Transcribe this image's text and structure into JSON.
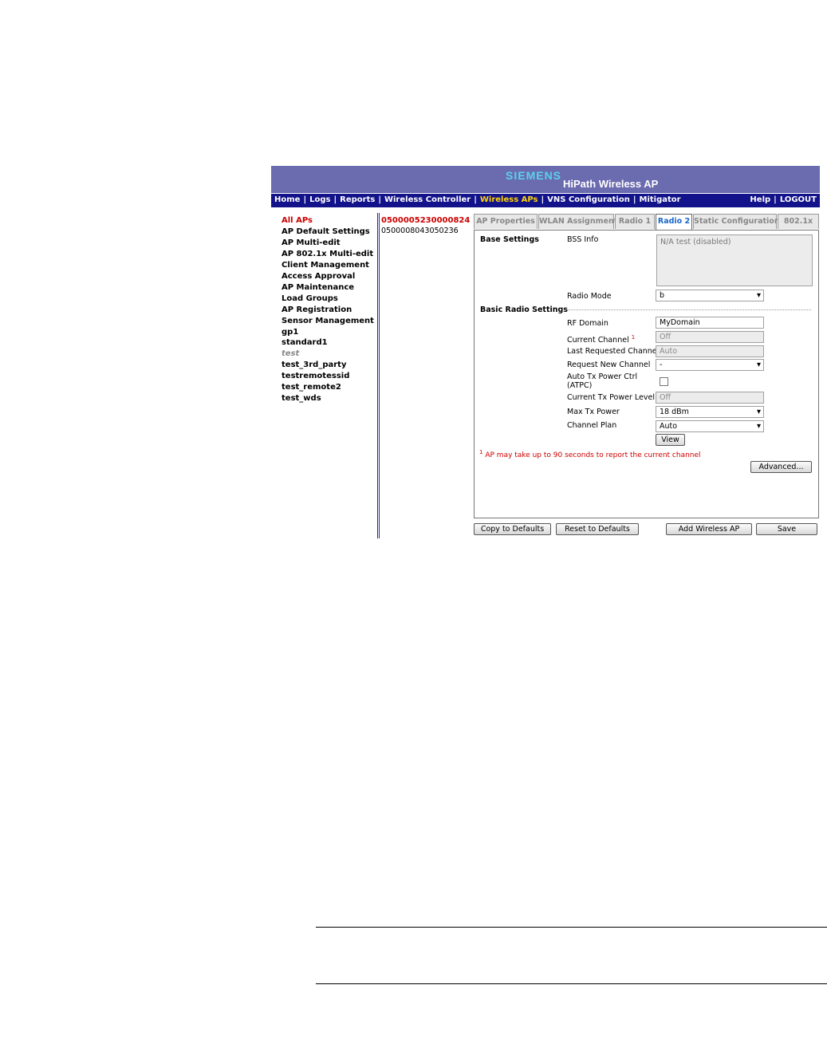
{
  "header": {
    "brand": "SIEMENS",
    "product": "HiPath Wireless AP"
  },
  "nav": {
    "left": [
      "Home",
      "Logs",
      "Reports",
      "Wireless Controller",
      "Wireless APs",
      "VNS Configuration",
      "Mitigator"
    ],
    "active": "Wireless APs",
    "right": [
      "Help",
      "LOGOUT"
    ],
    "separator": "|"
  },
  "sidebar": {
    "items": [
      {
        "label": "All APs",
        "state": "active"
      },
      {
        "label": "AP Default Settings"
      },
      {
        "label": "AP Multi-edit"
      },
      {
        "label": "AP 802.1x Multi-edit"
      },
      {
        "label": "Client Management"
      },
      {
        "label": "Access Approval"
      },
      {
        "label": "AP Maintenance"
      },
      {
        "label": "Load Groups"
      },
      {
        "label": "AP Registration"
      },
      {
        "label": "Sensor Management"
      },
      {
        "label": "gp1"
      },
      {
        "label": "standard1"
      },
      {
        "label": "test",
        "state": "disabled"
      },
      {
        "label": "test_3rd_party"
      },
      {
        "label": "testremotessid"
      },
      {
        "label": "test_remote2"
      },
      {
        "label": "test_wds"
      }
    ]
  },
  "ap_list": [
    "0500005230000824",
    "0500008043050236"
  ],
  "tabs": {
    "items": [
      "AP Properties",
      "WLAN Assignment",
      "Radio 1",
      "Radio 2",
      "Static Configuration",
      "802.1x"
    ],
    "active": "Radio 2"
  },
  "form": {
    "base_settings": "Base Settings",
    "bss_info_label": "BSS Info",
    "bss_info_value": "N/A  test (disabled)",
    "radio_mode_label": "Radio Mode",
    "radio_mode_value": "b",
    "basic_radio_settings": "Basic Radio Settings",
    "rf_domain_label": "RF Domain",
    "rf_domain_value": "MyDomain",
    "current_channel_label": "Current Channel",
    "current_channel_sup": "1",
    "current_channel_value": "Off",
    "last_requested_label": "Last Requested Channel",
    "last_requested_value": "Auto",
    "request_new_label": "Request New Channel",
    "request_new_value": "-",
    "atpc_label_1": "Auto Tx Power Ctrl",
    "atpc_label_2": "(ATPC)",
    "atpc_checked": false,
    "current_tx_label": "Current Tx Power Level",
    "current_tx_value": "Off",
    "max_tx_label": "Max Tx Power",
    "max_tx_value": "18 dBm",
    "channel_plan_label": "Channel Plan",
    "channel_plan_value": "Auto",
    "view_button": "View",
    "footnote_mark": "1",
    "footnote": "AP may take up to 90 seconds to report the current channel",
    "advanced_button": "Advanced..."
  },
  "buttons": {
    "copy_defaults": "Copy to Defaults",
    "reset_defaults": "Reset to Defaults",
    "add_ap": "Add Wireless AP",
    "save": "Save"
  },
  "colors": {
    "banner": "#6b6bb0",
    "navbar": "#12128a",
    "active_nav": "#ffd400",
    "accent_red": "#cc0000",
    "active_tab": "#1a66c9"
  }
}
